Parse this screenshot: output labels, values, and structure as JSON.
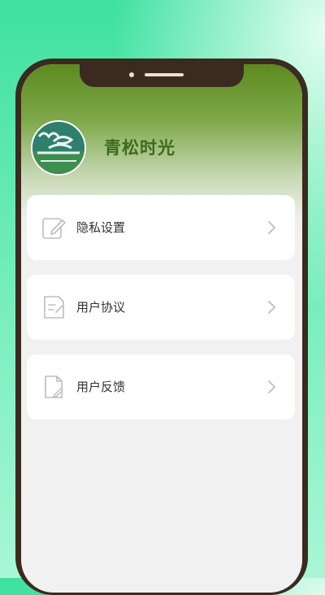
{
  "app": {
    "title": "青松时光"
  },
  "menu": {
    "items": [
      {
        "label": "隐私设置",
        "icon": "edit-icon"
      },
      {
        "label": "用户协议",
        "icon": "document-icon"
      },
      {
        "label": "用户反馈",
        "icon": "feedback-icon"
      }
    ]
  },
  "colors": {
    "accent": "#3c6b1d",
    "header_top": "#5d8a1f",
    "frame": "#3a2a1f",
    "background_green": "#3fe1a0"
  }
}
